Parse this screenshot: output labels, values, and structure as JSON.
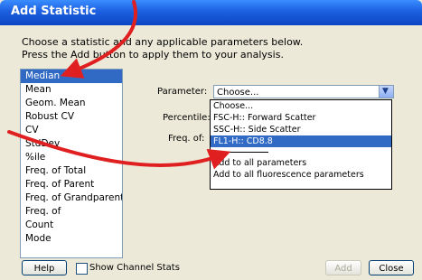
{
  "window": {
    "title": "Add Statistic"
  },
  "instructions": {
    "line1": "Choose a statistic and any applicable parameters below.",
    "line2": "Press the Add button to apply them to your analysis."
  },
  "statistics": {
    "items": [
      "Median",
      "Mean",
      "Geom. Mean",
      "Robust CV",
      "CV",
      "StdDev",
      "%ile",
      "Freq. of Total",
      "Freq. of Parent",
      "Freq. of Grandparent",
      "Freq. of",
      "Count",
      "Mode"
    ],
    "selected": "Median"
  },
  "parameter": {
    "label": "Parameter:",
    "value": "Choose...",
    "options": [
      "Choose...",
      "FSC-H:: Forward Scatter",
      "SSC-H:: Side Scatter",
      "FL1-H:: CD8.8"
    ],
    "selected_option": "FL1-H:: CD8.8",
    "extra_options": [
      "Add to all parameters",
      "Add to all fluorescence parameters"
    ]
  },
  "percentile": {
    "label": "Percentile:"
  },
  "freq_of": {
    "label": "Freq. of:"
  },
  "footer": {
    "help_label": "Help",
    "show_channel_stats_label": "Show Channel Stats",
    "add_label": "Add",
    "close_label": "Close"
  },
  "colors": {
    "selection": "#316ac5",
    "annotation_arrow": "#e02020",
    "titlebar": "#1c5fe0"
  }
}
